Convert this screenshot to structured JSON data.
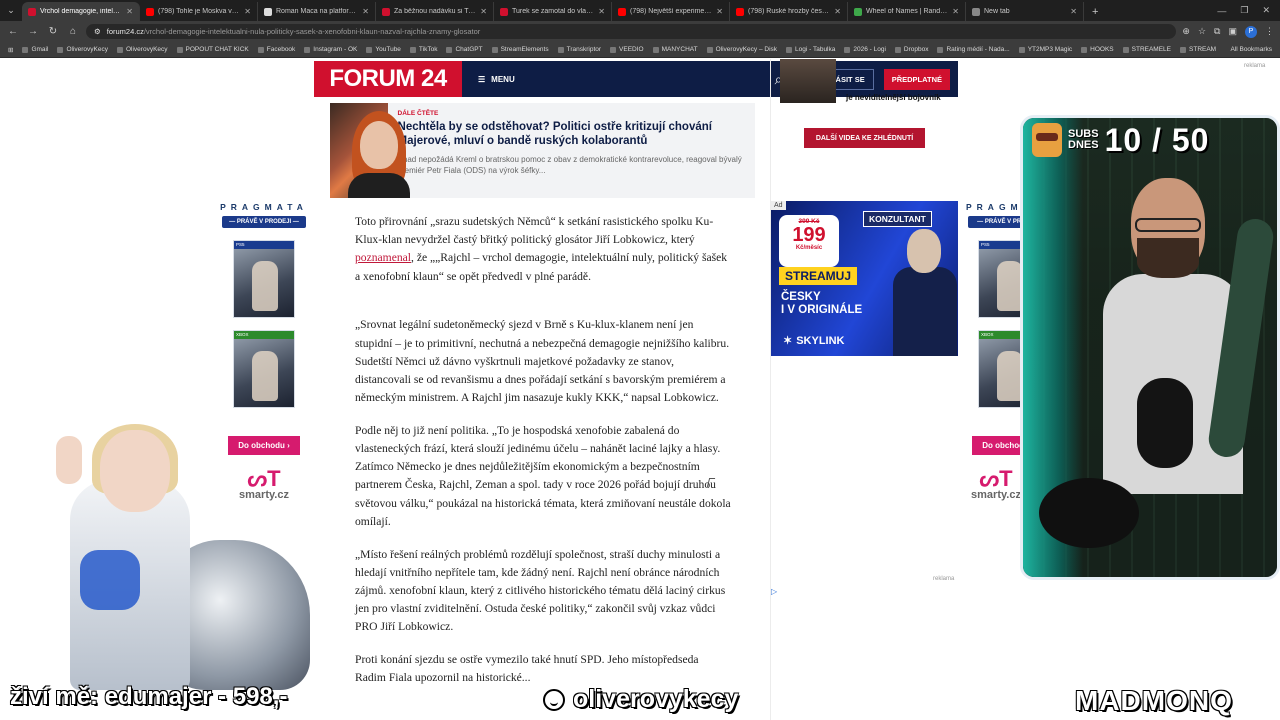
{
  "browser": {
    "tabs": [
      {
        "title": "Vrchol demagogie, intelektuální",
        "active": true,
        "color": "#d0102e"
      },
      {
        "title": "(798) Tohle je Moskva v dubnu",
        "active": false,
        "color": "#ff0000"
      },
      {
        "title": "Roman Maca na platformě X: \"",
        "active": false,
        "color": "#dddddd"
      },
      {
        "title": "Za běžnou nadávku si Turek v",
        "active": false,
        "color": "#d0102e"
      },
      {
        "title": "Turek se zamotal do vlastních",
        "active": false,
        "color": "#d0102e"
      },
      {
        "title": "(798) Největší experiment s čes",
        "active": false,
        "color": "#ff0000"
      },
      {
        "title": "(798) Ruské hrozby českým zb",
        "active": false,
        "color": "#ff0000"
      },
      {
        "title": "Wheel of Names | Random nam",
        "active": false,
        "color": "#3ea84a"
      },
      {
        "title": "New tab",
        "active": false,
        "color": "#888888"
      }
    ],
    "url_domain": "forum24.cz",
    "url_path": "/vrchol-demagogie-intelektualni-nula-politicky-sasek-a-xenofobni-klaun-nazval-rajchla-znamy-glosator",
    "profile_letter": "P",
    "bookmarks": [
      "Gmail",
      "OliverovyKecy",
      "OliverovyKecy",
      "POPOUT CHAT KICK",
      "Facebook",
      "Instagram - OK",
      "YouTube",
      "TikTok",
      "ChatGPT",
      "StreamElements",
      "Transkriptor",
      "VEEDIO",
      "MANYCHAT",
      "OliverovyKecy – Disk",
      "Logi - Tabulka",
      "2026 - Logi",
      "Dropbox",
      "Rating médií - Nada...",
      "YT2MP3 Magic",
      "HOOKS",
      "STREAMELE",
      "STREAM"
    ],
    "all_bookmarks": "All Bookmarks"
  },
  "site": {
    "logo": "FORUM 24",
    "menu_label": "MENU",
    "login_label": "PŘIHLÁSIT SE",
    "subscribe_label": "PŘEDPLATNÉ",
    "reklama": "reklama"
  },
  "related": {
    "kicker": "DÁLE ČTĚTE",
    "title": "Nechtěla by se odstěhovat? Politici ostře kritizují chování Majerové, mluví o bandě ruských kolaborantů",
    "perex": "Snad nepožádá Kreml o bratrskou pomoc z obav z demokratické kontrarevoluce, reagoval bývalý premiér Petr Fiala (ODS) na výrok šéfky..."
  },
  "article": {
    "p1_before": "Toto přirovnání „srazu sudetských Němců“ k setkání rasistického spolku Ku-Klux-klan nevydržel častý břitký politický glosátor Jiří Lobkowicz, který ",
    "p1_link": "poznamenal",
    "p1_after": ", že „„Rajchl – vrchol demagogie, intelektuální nuly, politický šašek a xenofobní klaun“ se opět předvedl v plné parádě.",
    "p2": "„Srovnat legální sudetoněmecký sjezd v Brně s Ku-klux-klanem není jen stupidní – je to primitivní, nechutná a nebezpečná demagogie nejnižšího kalibru. Sudetští Němci už dávno vyškrtnuli majetkové požadavky ze stanov, distancovali se od revanšismu a dnes pořádají setkání s bavorským premiérem a německým ministrem. A Rajchl jim nasazuje kukly KKK,“ napsal Lobkowicz.",
    "p3": "Podle něj to již není politika. „To je hospodská xenofobie zabalená do vlasteneckých frází, která slouží jedinému účelu – nahánět laciné lajky a hlasy. Zatímco Německo je dnes nejdůležitějším ekonomickým a bezpečnostním partnerem Česka, Rajchl, Zeman a spol. tady v roce 2026 pořád bojují druhou světovou válku,“ poukázal na historická témata, která zmiňovaní neustále dokola omílají.",
    "p4": "„Místo řešení reálných problémů rozdělují společnost, straší duchy minulosti a hledají vnitřního nepřítele tam, kde žádný není. Rajchl není obránce národních zájmů. xenofobní klaun, který z citlivého historického tématu dělá laciný cirkus jen pro vlastní zviditelnění. Ostuda české politiky,“ zakončil svůj vzkaz vůdci PRO Jiří Lobkowicz.",
    "p5": "Proti konání sjezdu se ostře vymezilo také hnutí SPD. Jeho místopředseda Radim Fiala upozornil na historické..."
  },
  "sidebar": {
    "video_caption": "je neviditelnější bojovník",
    "more_videos": "DALŠÍ VIDEA KE ZHLÉDNUTÍ",
    "ad_label": "Ad",
    "skylink": {
      "consultant": "KONZULTANT",
      "old_price": "399 Kč",
      "price": "199",
      "unit": "Kč/měsíc",
      "stream": "STREAMUJ",
      "line1": "ČESKY",
      "line2": "I V ORIGINÁLE",
      "brand": "SKYLINK"
    }
  },
  "left_ad": {
    "brand": "PRAGMATA",
    "cta": "— PRÁVĚ V PRODEJI —",
    "ps_label": "PS5",
    "xbox_label": "XBOX",
    "shop_btn": "Do obchodu ›",
    "smarty": "smarty.cz"
  },
  "overlay": {
    "subs_label_line1": "SUBS",
    "subs_label_line2": "DNES",
    "subs_count": "10 / 50",
    "donation": "živí mě: edumajer - 598,-",
    "channel": "oliverovykecy",
    "brand": "MADMONQ"
  }
}
